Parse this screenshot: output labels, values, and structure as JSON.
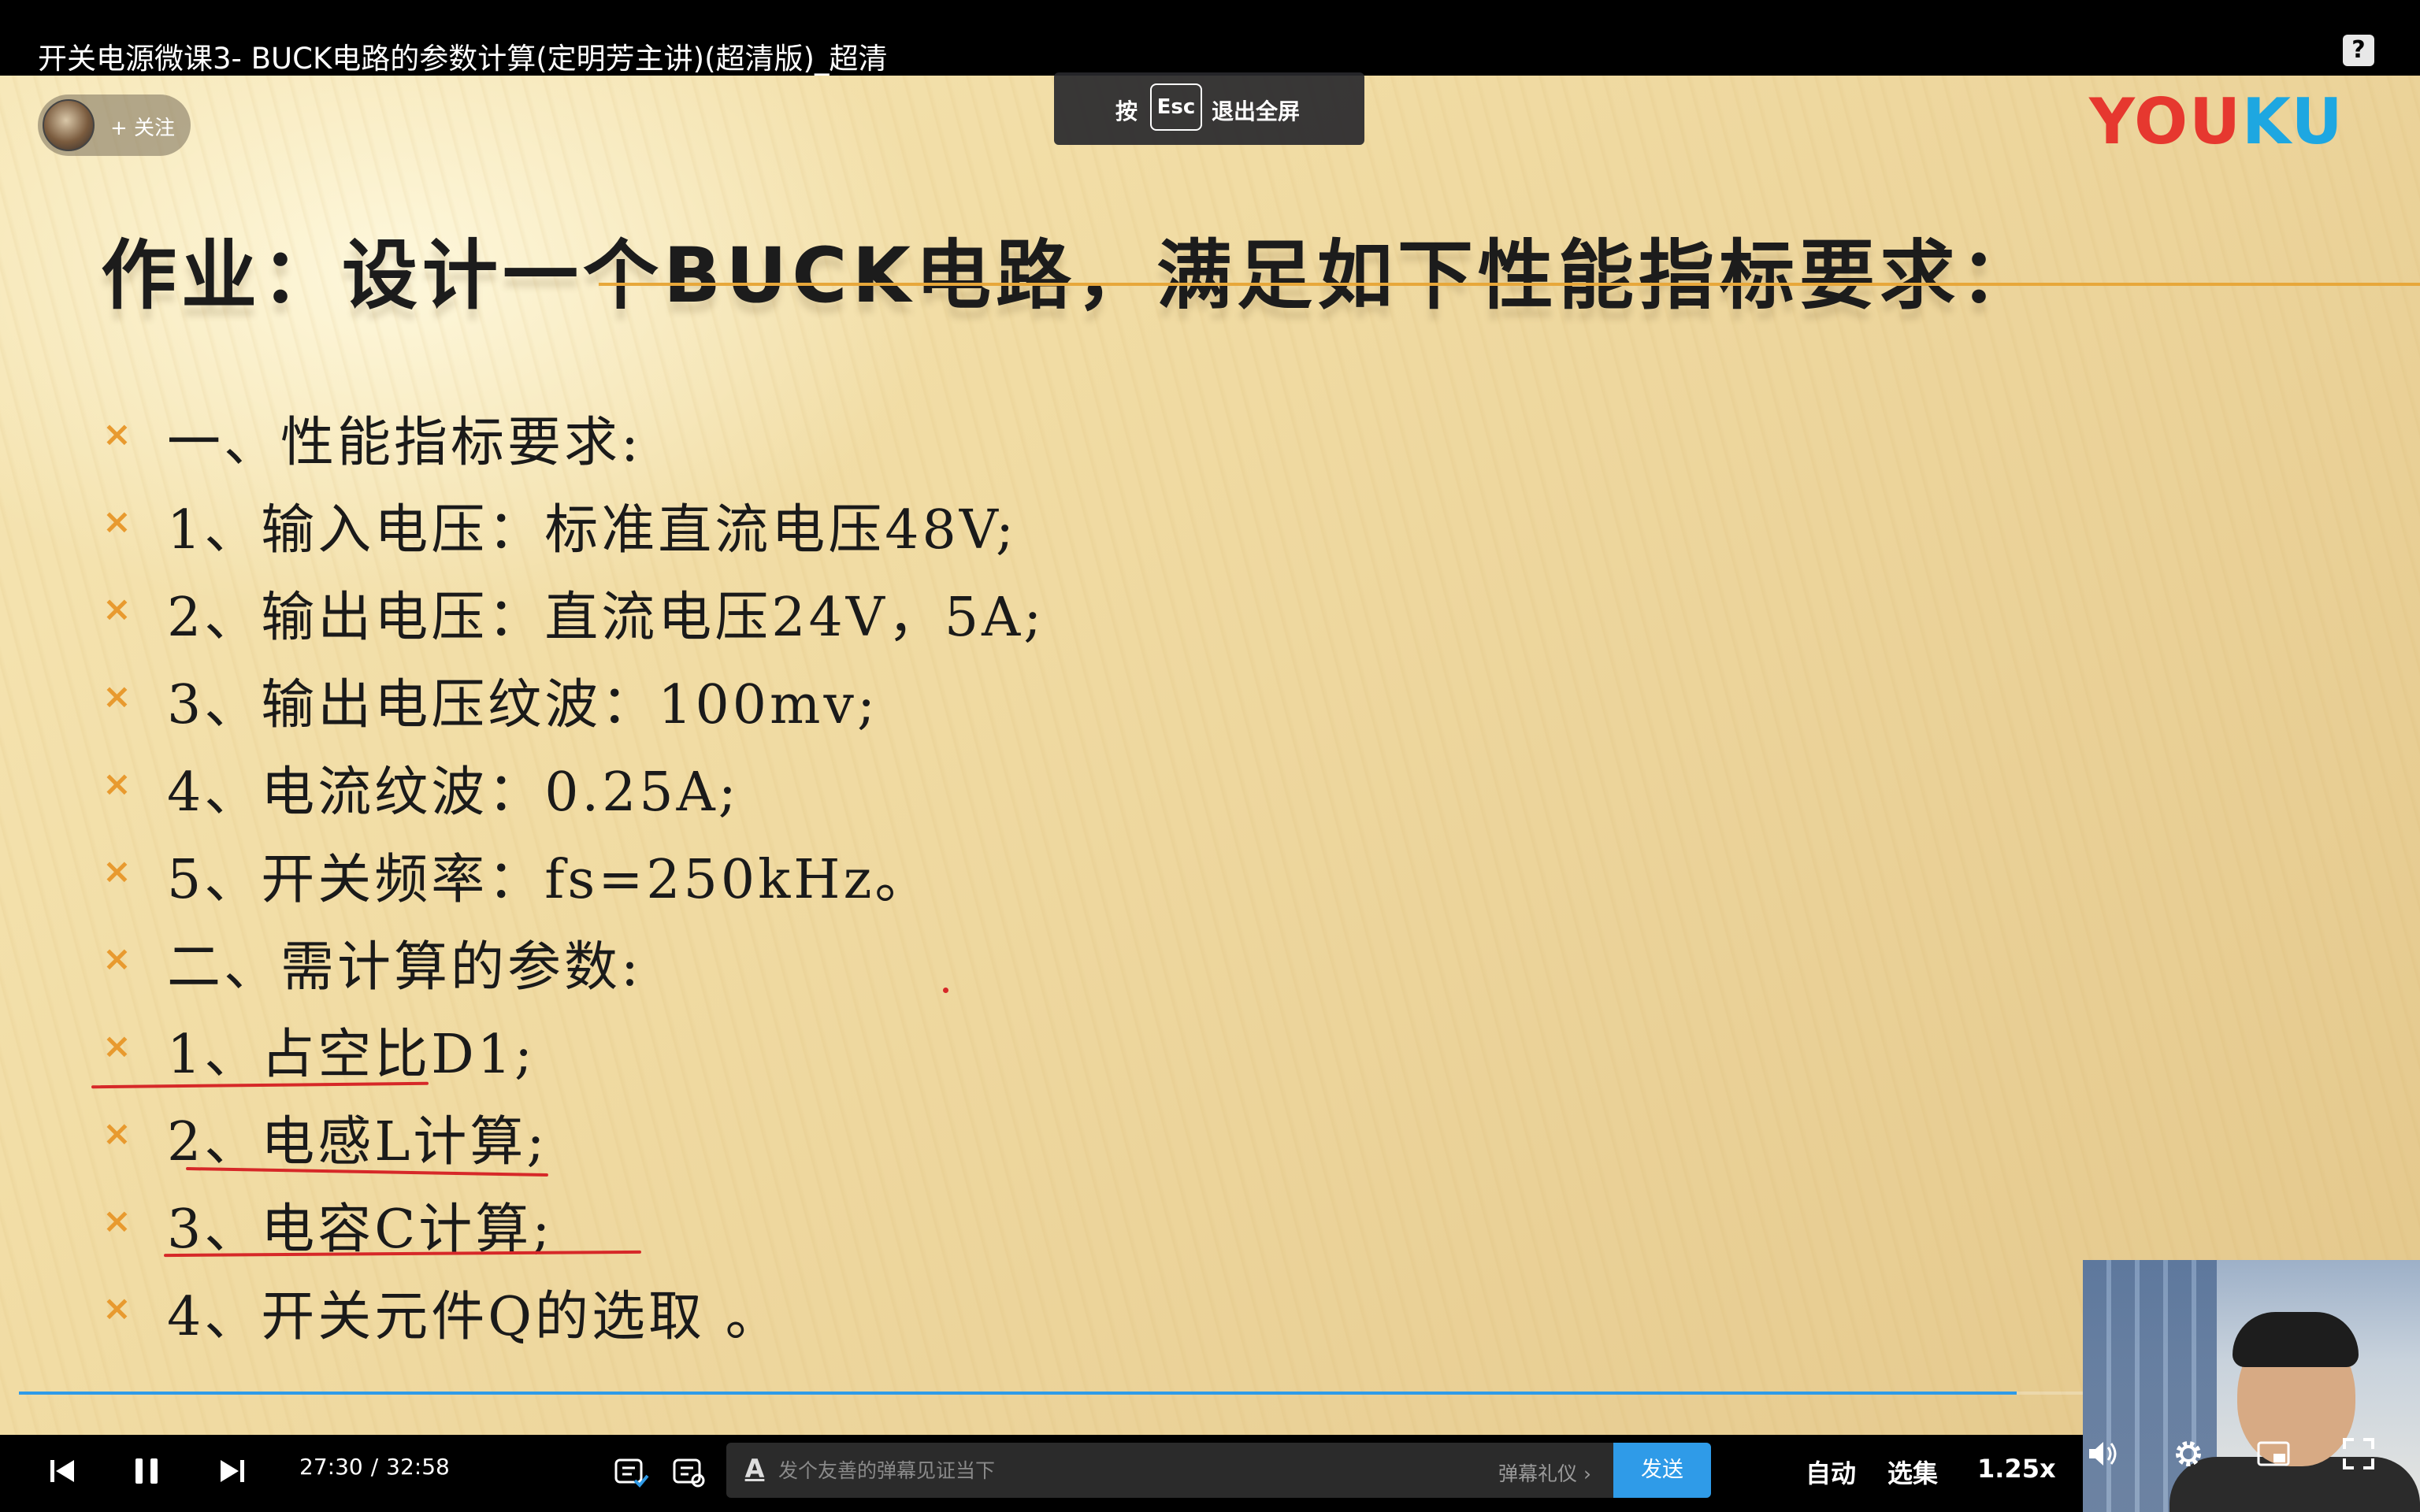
{
  "window": {
    "title": "开关电源微课3- BUCK电路的参数计算(定明芳主讲)(超清版)_超清",
    "help_icon": "?"
  },
  "follow": {
    "label": "+ 关注"
  },
  "esc_toast": {
    "press": "按",
    "key": "Esc",
    "exit": "退出全屏"
  },
  "logo": {
    "part1": "YOU",
    "part2": "KU"
  },
  "slide": {
    "title": "作业：设计一个BUCK电路，满足如下性能指标要求：",
    "bullet_mark": "×",
    "bullets": [
      "一、性能指标要求:",
      "1、输入电压：标准直流电压48V;",
      "2、输出电压：直流电压24V，5A;",
      "3、输出电压纹波：100mv;",
      "4、电流纹波：0.25A;",
      "5、开关频率：fs=250kHz。",
      "二、需计算的参数:",
      "1、占空比D1;",
      "2、电感L计算;",
      "3、电容C计算;",
      "4、开关元件Q的选取 。"
    ]
  },
  "player": {
    "progress": 0.8385,
    "time_current": "27:30",
    "time_separator": "/",
    "time_total": "32:58",
    "danmaku_placeholder": "发个友善的弹幕见证当下",
    "danmaku_etiquette": "弹幕礼仪 ›",
    "send_label": "发送",
    "quality_label": "自动",
    "episodes_label": "选集",
    "speed_label": "1.25x"
  },
  "colors": {
    "accent": "#2f9be8",
    "bullet": "#e89a2f",
    "annotation": "#d62828",
    "logo_red": "#e6382f",
    "logo_blue": "#1ea7e1"
  }
}
